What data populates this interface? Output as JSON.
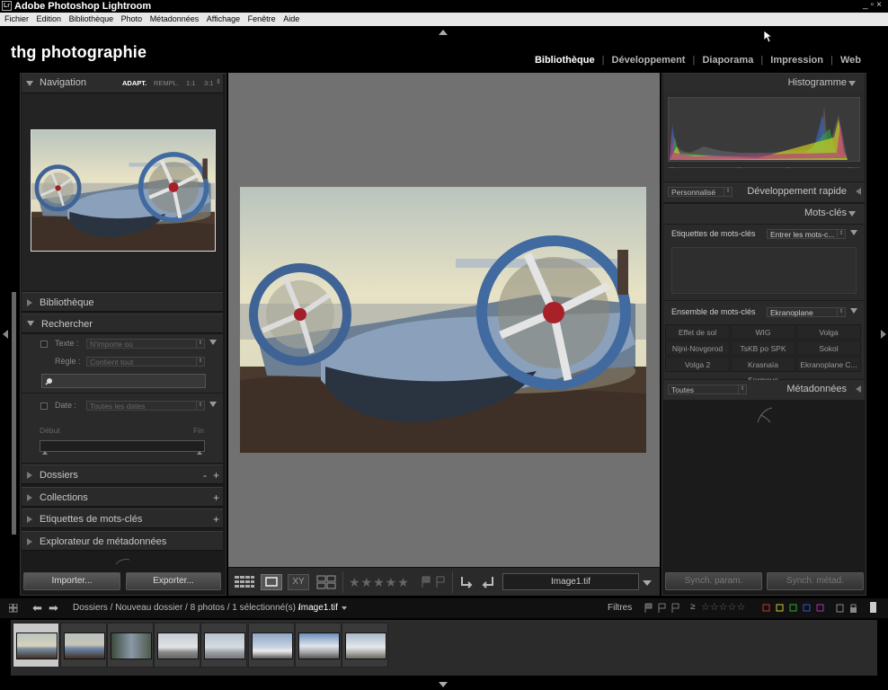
{
  "app": {
    "title": "Adobe Photoshop Lightroom",
    "icon": "Lr"
  },
  "window_controls": [
    "_",
    "▫",
    "×"
  ],
  "menu": [
    "Fichier",
    "Edition",
    "Bibliothèque",
    "Photo",
    "Métadonnées",
    "Affichage",
    "Fenêtre",
    "Aide"
  ],
  "brand": "thg photographie",
  "modules": [
    "Bibliothèque",
    "Développement",
    "Diaporama",
    "Impression",
    "Web"
  ],
  "active_module": "Bibliothèque",
  "navigator": {
    "title": "Navigation",
    "zoom": [
      "ADAPT.",
      "REMPL.",
      "1:1",
      "3:1"
    ]
  },
  "left": {
    "bibliotheque": "Bibliothèque",
    "rechercher": "Rechercher",
    "texte_label": "Texte :",
    "texte_value": "N'importe où",
    "regle_label": "Règle :",
    "regle_value": "Contient tout",
    "date_label": "Date :",
    "date_value": "Toutes les dates",
    "debut": "Début",
    "fin": "Fin",
    "dossiers": "Dossiers",
    "dossiers_minus": "-",
    "plus": "+",
    "collections": "Collections",
    "etiquettes": "Etiquettes de mots-clés",
    "explorateur": "Explorateur de métadonnées",
    "import": "Importer...",
    "export": "Exporter..."
  },
  "right": {
    "histogramme": "Histogramme",
    "preset": "Personnalisé",
    "dev_rapide": "Développement rapide",
    "mots_cles": "Mots-clés",
    "etiq_label": "Etiquettes de mots-clés",
    "etiq_value": "Entrer les mots-c...",
    "ensemble_label": "Ensemble de mots-clés",
    "ensemble_value": "Ekranoplane",
    "keywords": [
      "Effet de sol",
      "WIG",
      "Volga",
      "Nijni-Novgorod",
      "TsKB po SPK",
      "Sokol",
      "Volga 2",
      "Krasnaïa Sormovo",
      "Ekranoplane C..."
    ],
    "meta_preset": "Toutes",
    "metadonnees": "Métadonnées",
    "sync_param": "Synch. param.",
    "sync_meta": "Synch. métad."
  },
  "toolbar": {
    "filename": "Image1.tif",
    "stars": "★★★★★"
  },
  "filmstrip": {
    "path": "Dossiers / Nouveau dossier / 8 photos / 1 sélectionné(s) /",
    "current": "Image1.tif",
    "filters": "Filtres",
    "rating_op": "≥",
    "rating_stars": "☆☆☆☆☆"
  },
  "colors": {
    "accent_text": "#ffffff",
    "panel_bg": "#1b1b1b",
    "center_bg": "#717171"
  }
}
